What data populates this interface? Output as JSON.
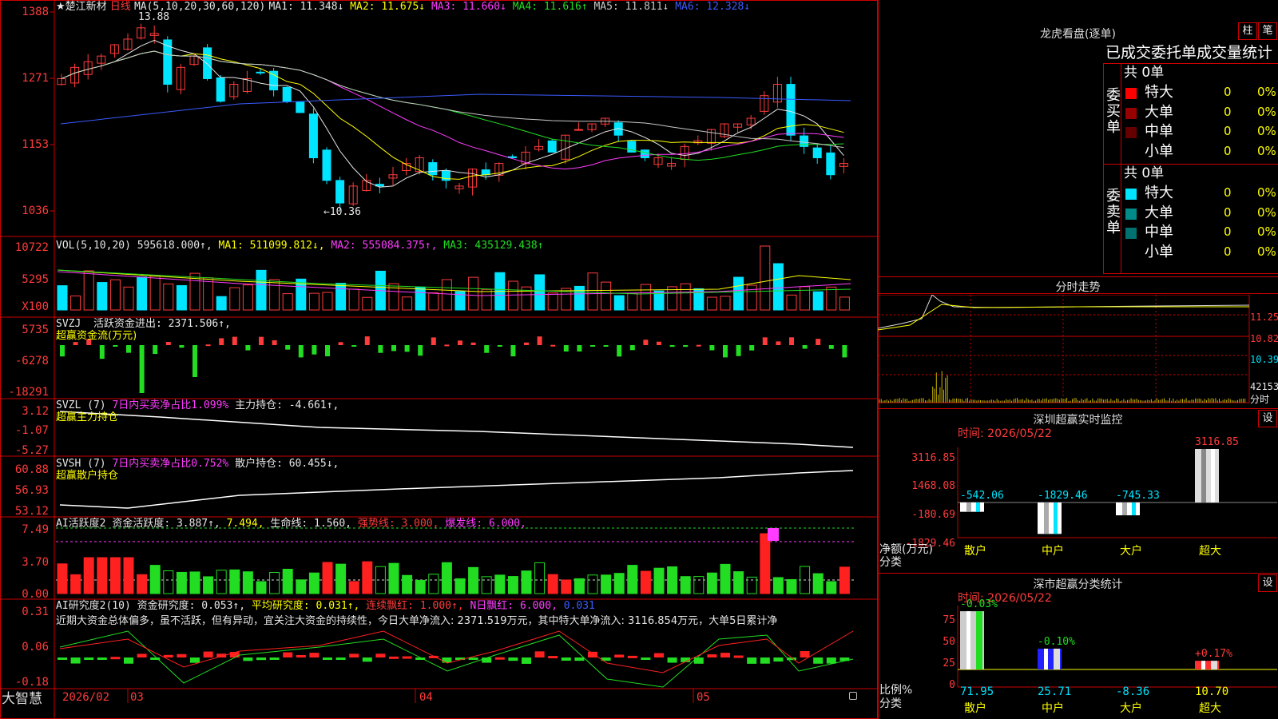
{
  "stock": {
    "title": "★楚江新材",
    "period": "日线",
    "ma_label": "MA(5,10,20,30,60,120)",
    "ma": [
      {
        "text": "MA1: 11.348↓",
        "color": "#e6e6e6"
      },
      {
        "text": "MA2: 11.675↓",
        "color": "#ffff00"
      },
      {
        "text": "MA3: 11.660↓",
        "color": "#ff3cff"
      },
      {
        "text": "MA4: 11.616↑",
        "color": "#22dd22"
      },
      {
        "text": "MA5: 11.811↓",
        "color": "#c8c8c8"
      },
      {
        "text": "MA6: 12.328↓",
        "color": "#3a5bff"
      }
    ],
    "y_labels": [
      "1388",
      "1271",
      "1153",
      "1036"
    ],
    "high_mark": "13.88",
    "low_mark": "←10.36"
  },
  "vol": {
    "label": "VOL(5,10,20)",
    "val": "595618.000↑,",
    "ma1": "MA1: 511099.812↓,",
    "ma2": "MA2: 555084.375↑,",
    "ma3": "MA3: 435129.438↑",
    "y_labels": [
      "10722",
      "5295",
      "X100"
    ]
  },
  "svzj": {
    "label": "SVZJ",
    "text": "活跃资金进出: 2371.506↑,",
    "sub": "超赢资金流(万元)",
    "y_labels": [
      "5735",
      "-6278",
      "-18291"
    ]
  },
  "svzl": {
    "label": "SVZL (7)",
    "t1": "7日内买卖净占比1.099%",
    "t2": "主力持仓: -4.661↑,",
    "sub": "超赢主力持仓",
    "y_labels": [
      "3.12",
      "-1.07",
      "-5.27"
    ]
  },
  "svsh": {
    "label": "SVSH (7)",
    "t1": "7日内买卖净占比0.752%",
    "t2": "散户持仓: 60.455↓,",
    "sub": "超赢散户持仓",
    "y_labels": [
      "60.88",
      "56.93",
      "53.12"
    ]
  },
  "ai2": {
    "label": "AI活跃度2",
    "t1": "资金活跃度: 3.887↑,",
    "t2": "7.494,",
    "t3": "生命线: 1.560,",
    "t4": "强势线: 3.000,",
    "t5": "爆发线: 6.000,",
    "y_labels": [
      "7.49",
      "3.70",
      "0.00"
    ]
  },
  "ai_res": {
    "label": "AI研究度2(10)",
    "t1": "资金研究度: 0.053↑,",
    "t2": "平均研究度: 0.031↑,",
    "t3": "连续飘红: 1.000↑,",
    "t4": "N日飘红: 6.000,",
    "t5": "0.031",
    "comment": "近期大资金总体偏多，虽不活跃，但有异动，宜关注大资金的持续性，今日大单净流入: 2371.519万元，其中特大单净流入: 3116.854万元，大单5日累计净",
    "y_labels": [
      "0.31",
      "0.06",
      "-0.18"
    ]
  },
  "bottom_bar": {
    "brand": "大智慧",
    "dates": [
      "2026/02",
      "03",
      "04",
      "05"
    ]
  },
  "longhu": {
    "title": "龙虎看盘(逐单)",
    "btn1": "柱",
    "btn2": "笔",
    "subtitle": "已成交委托单成交量统计",
    "buy_label": "委买单",
    "sell_label": "委卖单",
    "buy_total": "共 0单",
    "sell_total": "共 0单",
    "buy_rows": [
      {
        "name": "特大",
        "count": "0",
        "pct": "0%",
        "color": "#ff0000"
      },
      {
        "name": "大单",
        "count": "0",
        "pct": "0%",
        "color": "#990000"
      },
      {
        "name": "中单",
        "count": "0",
        "pct": "0%",
        "color": "#660000"
      },
      {
        "name": "小单",
        "count": "0",
        "pct": "0%",
        "color": ""
      }
    ],
    "sell_rows": [
      {
        "name": "特大",
        "count": "0",
        "pct": "0%",
        "color": "#00e5ff"
      },
      {
        "name": "大单",
        "count": "0",
        "pct": "0%",
        "color": "#008a8a"
      },
      {
        "name": "中单",
        "count": "0",
        "pct": "0%",
        "color": "#007070"
      },
      {
        "name": "小单",
        "count": "0",
        "pct": "0%",
        "color": ""
      }
    ]
  },
  "intraday": {
    "title": "分时走势",
    "y_labels": [
      "11.25",
      "10.82",
      "10.39",
      "42153",
      "分时"
    ]
  },
  "monitor": {
    "title": "深圳超赢实时监控",
    "settings": "设",
    "time": "时间: 2026/05/22",
    "y_labels": [
      "3116.85",
      "1468.08",
      "-180.69",
      "-1829.46"
    ],
    "unit": "净额(万元)",
    "cat_label": "分类",
    "bars": [
      {
        "cat": "散户",
        "value": -542.06,
        "label": "-542.06"
      },
      {
        "cat": "中户",
        "value": -1829.46,
        "label": "-1829.46"
      },
      {
        "cat": "大户",
        "value": -745.33,
        "label": "-745.33"
      },
      {
        "cat": "超大",
        "value": 3116.85,
        "label": "3116.85"
      }
    ]
  },
  "classify": {
    "title": "深市超赢分类统计",
    "settings": "设",
    "time": "时间: 2026/05/22",
    "y_labels": [
      "75",
      "50",
      "25",
      "0"
    ],
    "unit": "比例%",
    "cat_label": "分类",
    "bars": [
      {
        "cat": "散户",
        "value": 71.95,
        "label": "71.95",
        "change": "-0.03%"
      },
      {
        "cat": "中户",
        "value": 25.71,
        "label": "25.71",
        "change": "-0.10%"
      },
      {
        "cat": "大户",
        "value": -8.36,
        "label": "-8.36",
        "change": ""
      },
      {
        "cat": "超大",
        "value": 10.7,
        "label": "10.70",
        "change": "+0.17%"
      }
    ]
  }
}
